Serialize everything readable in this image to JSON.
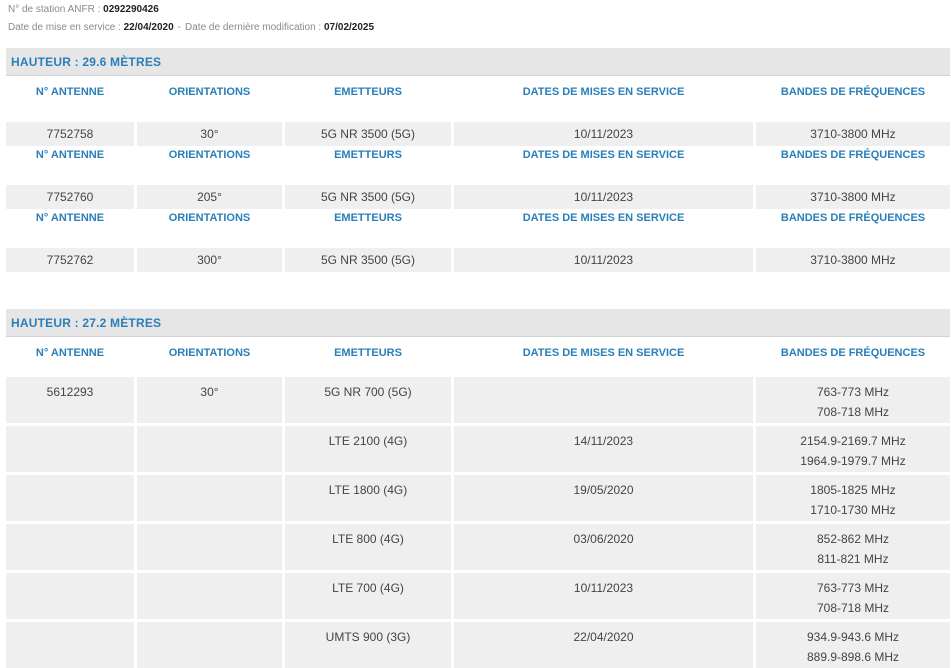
{
  "station": {
    "anfr_label": "N° de station ANFR : ",
    "anfr_value": "0292290426",
    "service_date_label": "Date de mise en service : ",
    "service_date_value": "22/04/2020",
    "separator": "-",
    "modified_label": "Date de dernière modification : ",
    "modified_value": "07/02/2025"
  },
  "columns": {
    "antenna": "N° ANTENNE",
    "orientations": "ORIENTATIONS",
    "emitters": "EMETTEURS",
    "dates": "DATES DE MISES EN SERVICE",
    "bands": "BANDES DE FRÉQUENCES"
  },
  "sections": [
    {
      "title": "HAUTEUR : 29.6 MÈTRES",
      "antennas": [
        {
          "id": "7752758",
          "orientation": "30°",
          "rows": [
            {
              "emitter": "5G NR 3500 (5G)",
              "date": "10/11/2023",
              "bands": [
                "3710-3800 MHz"
              ]
            }
          ]
        },
        {
          "id": "7752760",
          "orientation": "205°",
          "rows": [
            {
              "emitter": "5G NR 3500 (5G)",
              "date": "10/11/2023",
              "bands": [
                "3710-3800 MHz"
              ]
            }
          ]
        },
        {
          "id": "7752762",
          "orientation": "300°",
          "rows": [
            {
              "emitter": "5G NR 3500 (5G)",
              "date": "10/11/2023",
              "bands": [
                "3710-3800 MHz"
              ]
            }
          ]
        }
      ]
    },
    {
      "title": "HAUTEUR : 27.2 MÈTRES",
      "antennas": [
        {
          "id": "5612293",
          "orientation": "30°",
          "rows": [
            {
              "emitter": "5G NR 700 (5G)",
              "date": "",
              "bands": [
                "763-773 MHz",
                "708-718 MHz"
              ]
            },
            {
              "emitter": "LTE 2100 (4G)",
              "date": "14/11/2023",
              "bands": [
                "2154.9-2169.7 MHz",
                "1964.9-1979.7 MHz"
              ]
            },
            {
              "emitter": "LTE 1800 (4G)",
              "date": "19/05/2020",
              "bands": [
                "1805-1825 MHz",
                "1710-1730 MHz"
              ]
            },
            {
              "emitter": "LTE 800 (4G)",
              "date": "03/06/2020",
              "bands": [
                "852-862 MHz",
                "811-821 MHz"
              ]
            },
            {
              "emitter": "LTE 700 (4G)",
              "date": "10/11/2023",
              "bands": [
                "763-773 MHz",
                "708-718 MHz"
              ]
            },
            {
              "emitter": "UMTS 900 (3G)",
              "date": "22/04/2020",
              "bands": [
                "934.9-943.6 MHz",
                "889.9-898.6 MHz"
              ]
            }
          ]
        }
      ]
    }
  ]
}
